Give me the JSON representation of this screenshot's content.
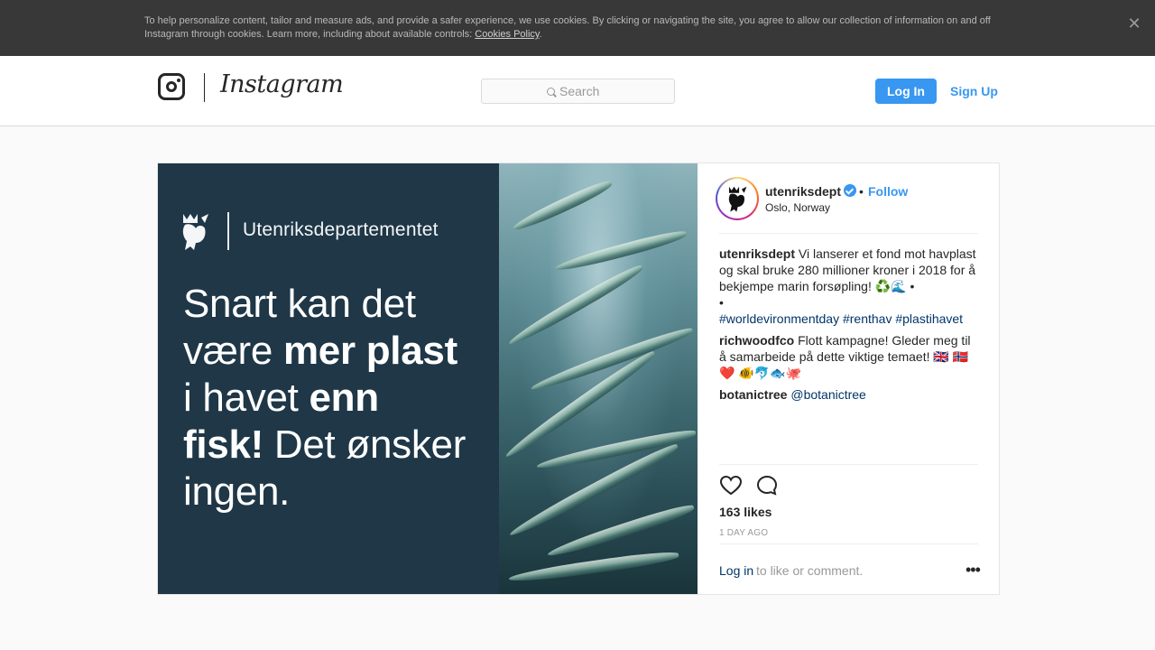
{
  "cookie_banner": {
    "text": "To help personalize content, tailor and measure ads, and provide a safer experience, we use cookies. By clicking or navigating the site, you agree to allow our collection of information on and off Instagram through cookies. Learn more, including about available controls: ",
    "link_text": "Cookies Policy",
    "suffix": ".",
    "close_icon": "close-icon",
    "close_glyph": "✕"
  },
  "header": {
    "wordmark": "Instagram",
    "search_placeholder": "Search",
    "login_label": "Log In",
    "signup_label": "Sign Up",
    "accent_color": "#3897f0"
  },
  "post": {
    "image": {
      "brand_text": "Utenriksdepartementet",
      "headline_1": "Snart kan det",
      "headline_2a": "være ",
      "headline_2b": "mer plast",
      "headline_3a": "i havet ",
      "headline_3b": "enn",
      "headline_4a": "fisk!",
      "headline_4b": " Det ønsker",
      "headline_5": "ingen."
    },
    "author": {
      "username": "utenriksdept",
      "verified": true,
      "separator": "•",
      "follow_label": "Follow",
      "location": "Oslo, Norway"
    },
    "caption": {
      "username": "utenriksdept",
      "text": " Vi lanserer et fond mot havplast og skal bruke 280 millioner kroner i 2018 for å bekjempe marin forsøpling! ♻️🌊 •",
      "line_break": "•",
      "hashtags": [
        "#worldevironmentday",
        "#renthav",
        "#plastihavet"
      ]
    },
    "comments": [
      {
        "username": "richwoodfco",
        "text": " Flott kampagne! Gleder meg til å samarbeide på dette viktige temaet! 🇬🇧 🇳🇴 ❤️ 🐠🐬🐟🐙"
      },
      {
        "username": "botanictree",
        "mention": "@botanictree"
      }
    ],
    "likes": "163 likes",
    "time_ago": "1 DAY AGO",
    "login_link": "Log in",
    "login_rest": " to like or comment.",
    "more_glyph": "•••"
  }
}
